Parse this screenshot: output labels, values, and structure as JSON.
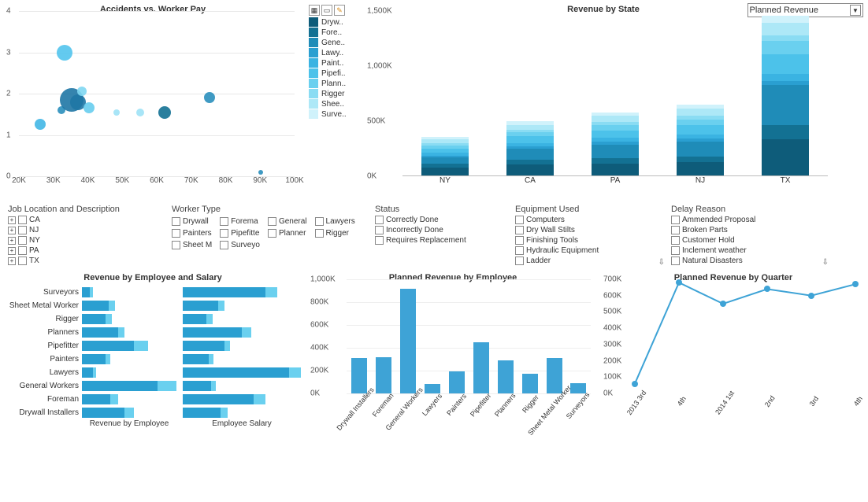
{
  "dropdown": {
    "selected": "Planned Revenue"
  },
  "chart_data": [
    {
      "id": "scatter",
      "type": "scatter",
      "title": "Accidents vs. Worker Pay",
      "xlabel": "",
      "ylabel": "",
      "xlim": [
        20000,
        100000
      ],
      "ylim": [
        0,
        4
      ],
      "xticks": [
        "20K",
        "30K",
        "40K",
        "50K",
        "60K",
        "70K",
        "80K",
        "90K",
        "100K"
      ],
      "yticks": [
        0,
        1,
        2,
        3,
        4
      ],
      "points": [
        {
          "x": 26000,
          "y": 1.25,
          "size": 14,
          "color": "#42b7e6"
        },
        {
          "x": 32000,
          "y": 1.6,
          "size": 10,
          "color": "#2a8fbd"
        },
        {
          "x": 33000,
          "y": 3.0,
          "size": 20,
          "color": "#52c4ed"
        },
        {
          "x": 35000,
          "y": 1.85,
          "size": 30,
          "color": "#1f77a5"
        },
        {
          "x": 37000,
          "y": 1.8,
          "size": 20,
          "color": "#1f77a5"
        },
        {
          "x": 38000,
          "y": 2.05,
          "size": 12,
          "color": "#7fd7f2"
        },
        {
          "x": 40000,
          "y": 1.65,
          "size": 14,
          "color": "#67cdee"
        },
        {
          "x": 48000,
          "y": 1.55,
          "size": 8,
          "color": "#9fe2f6"
        },
        {
          "x": 55000,
          "y": 1.55,
          "size": 10,
          "color": "#9fe2f6"
        },
        {
          "x": 62000,
          "y": 1.55,
          "size": 16,
          "color": "#137193"
        },
        {
          "x": 75000,
          "y": 1.9,
          "size": 14,
          "color": "#2a8fbd"
        },
        {
          "x": 90000,
          "y": 0.1,
          "size": 6,
          "color": "#2a8fbd"
        }
      ],
      "legend": {
        "icons": [
          "grid",
          "card",
          "pencil"
        ],
        "items": [
          {
            "label": "Dryw..",
            "color": "#0e5c7a"
          },
          {
            "label": "Fore..",
            "color": "#137193"
          },
          {
            "label": "Gene..",
            "color": "#1f8cb8"
          },
          {
            "label": "Lawy..",
            "color": "#2a9fd1"
          },
          {
            "label": "Paint..",
            "color": "#3ab3e2"
          },
          {
            "label": "Pipefi..",
            "color": "#4cc2ea"
          },
          {
            "label": "Plann..",
            "color": "#6ad0ef"
          },
          {
            "label": "Rigger",
            "color": "#8adcf3"
          },
          {
            "label": "Shee..",
            "color": "#ade8f7"
          },
          {
            "label": "Surve..",
            "color": "#d0f2fb"
          }
        ]
      }
    },
    {
      "id": "stacked",
      "type": "bar",
      "title": "Revenue by State",
      "ylim": [
        0,
        1500000
      ],
      "yticks": [
        "0K",
        "500K",
        "1,000K",
        "1,500K"
      ],
      "categories": [
        "NY",
        "CA",
        "PA",
        "NJ",
        "TX"
      ],
      "series_colors": [
        "#0e5c7a",
        "#137193",
        "#1f8cb8",
        "#2a9fd1",
        "#3ab3e2",
        "#4cc2ea",
        "#6ad0ef",
        "#8adcf3",
        "#ade8f7",
        "#d0f2fb"
      ],
      "stacks": {
        "NY": [
          70000,
          35000,
          60000,
          15000,
          25000,
          40000,
          30000,
          20000,
          35000,
          20000
        ],
        "CA": [
          100000,
          45000,
          100000,
          20000,
          30000,
          60000,
          35000,
          25000,
          45000,
          30000
        ],
        "PA": [
          110000,
          50000,
          120000,
          25000,
          35000,
          70000,
          45000,
          30000,
          55000,
          35000
        ],
        "NJ": [
          120000,
          55000,
          130000,
          30000,
          40000,
          80000,
          55000,
          35000,
          60000,
          40000
        ],
        "TX": [
          330000,
          130000,
          360000,
          40000,
          60000,
          180000,
          120000,
          55000,
          110000,
          65000
        ]
      }
    },
    {
      "id": "hbar",
      "type": "bar",
      "title": "Revenue by Employee and Salary",
      "sub_left": "Revenue by Employee",
      "sub_right": "Employee Salary",
      "categories": [
        "Surveyors",
        "Sheet Metal Worker",
        "Rigger",
        "Planners",
        "Pipefitter",
        "Painters",
        "Lawyers",
        "General Workers",
        "Foreman",
        "Drywall Installers"
      ],
      "revenue_a": [
        8,
        28,
        25,
        38,
        55,
        25,
        12,
        80,
        30,
        45
      ],
      "revenue_b": [
        12,
        35,
        32,
        45,
        70,
        30,
        15,
        100,
        38,
        55
      ],
      "salary_a": [
        70,
        30,
        20,
        50,
        35,
        22,
        90,
        24,
        60,
        32
      ],
      "salary_b": [
        80,
        35,
        25,
        58,
        40,
        26,
        100,
        28,
        70,
        38
      ]
    },
    {
      "id": "vbar",
      "type": "bar",
      "title": "Planned Revenue by Employee",
      "ylim": [
        0,
        1000000
      ],
      "yticks": [
        "0K",
        "200K",
        "400K",
        "600K",
        "800K",
        "1,000K"
      ],
      "categories": [
        "Drywall Installers",
        "Foreman",
        "General Workers",
        "Lawyers",
        "Painters",
        "Pipefitter",
        "Planners",
        "Rigger",
        "Sheet Metal Worker",
        "Surveyors"
      ],
      "values": [
        310000,
        320000,
        920000,
        80000,
        190000,
        450000,
        290000,
        170000,
        310000,
        90000
      ]
    },
    {
      "id": "line",
      "type": "line",
      "title": "Planned Revenue by Quarter",
      "ylim": [
        0,
        700000
      ],
      "yticks": [
        "0K",
        "100K",
        "200K",
        "300K",
        "400K",
        "500K",
        "600K",
        "700K"
      ],
      "categories": [
        "2013 3rd",
        "4th",
        "2014 1st",
        "2nd",
        "3rd",
        "4th"
      ],
      "values": [
        60000,
        680000,
        550000,
        640000,
        600000,
        670000
      ]
    }
  ],
  "filters": {
    "job_location": {
      "title": "Job Location and Description",
      "items": [
        "CA",
        "NJ",
        "NY",
        "PA",
        "TX"
      ]
    },
    "worker_type": {
      "title": "Worker Type",
      "cols": [
        [
          "Drywall",
          "Painters",
          "Sheet M"
        ],
        [
          "Forema",
          "Pipefitte",
          "Surveyo"
        ],
        [
          "General",
          "Planner"
        ],
        [
          "Lawyers",
          "Rigger"
        ]
      ]
    },
    "status": {
      "title": "Status",
      "items": [
        "Correctly Done",
        "Incorrectly Done",
        "Requires Replacement"
      ]
    },
    "equipment": {
      "title": "Equipment Used",
      "items": [
        "Computers",
        "Dry Wall Stilts",
        "Finishing Tools",
        "Hydraulic Equipment",
        "Ladder"
      ]
    },
    "delay": {
      "title": "Delay Reason",
      "items": [
        "Ammended Proposal",
        "Broken Parts",
        "Customer Hold",
        "Inclement weather",
        "Natural Disasters"
      ]
    }
  }
}
